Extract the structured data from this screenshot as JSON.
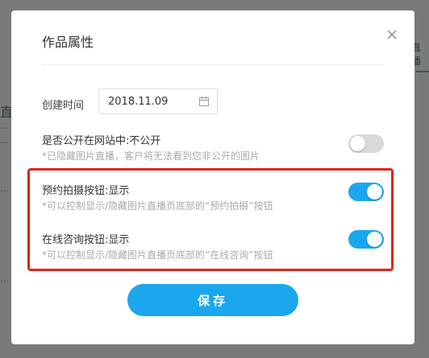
{
  "background": {
    "right_tab_fragment": "直播",
    "left_fragments": [
      "直",
      "…",
      "…",
      "…",
      "…"
    ]
  },
  "modal": {
    "title": "作品属性",
    "date": {
      "label": "创建时间",
      "value": "2018.11.09"
    },
    "settings": [
      {
        "title": "是否公开在网站中:不公开",
        "description": "*已隐藏图片直播，客户将无法看到您非公开的图片",
        "enabled": false
      },
      {
        "title": "预约拍摄按钮:显示",
        "description": "*可以控制显示/隐藏图片直播页底部的“预约拍摄”按钮",
        "enabled": true
      },
      {
        "title": "在线咨询按钮:显示",
        "description": "*可以控制显示/隐藏图片直播页底部的“在线咨询”按钮",
        "enabled": true
      }
    ],
    "save_label": "保存"
  },
  "colors": {
    "accent": "#1aa7ee",
    "toggle_off": "#d9d9d9",
    "highlight": "#e0241b",
    "overlay": "#7a7a7a"
  }
}
